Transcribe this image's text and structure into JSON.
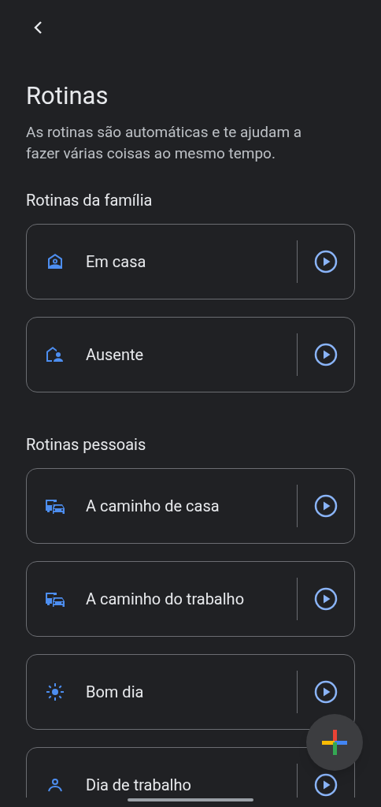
{
  "header": {
    "title": "Rotinas",
    "description": "As rotinas são automáticas e te ajudam a fazer várias coisas ao mesmo tempo."
  },
  "sections": [
    {
      "heading": "Rotinas da família",
      "routines": [
        {
          "name": "Em casa"
        },
        {
          "name": "Ausente"
        }
      ]
    },
    {
      "heading": "Rotinas pessoais",
      "routines": [
        {
          "name": "A caminho de casa"
        },
        {
          "name": "A caminho do trabalho"
        },
        {
          "name": "Bom dia"
        },
        {
          "name": "Dia de trabalho"
        }
      ]
    }
  ]
}
